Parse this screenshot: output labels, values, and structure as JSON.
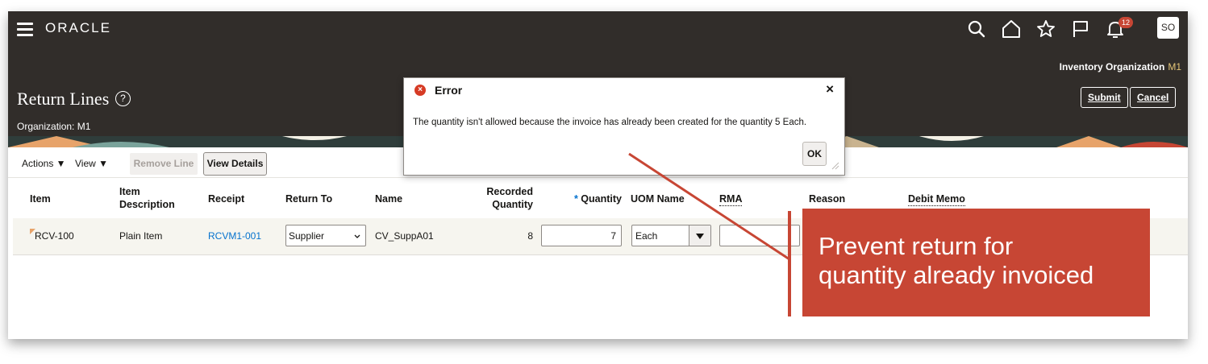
{
  "app": {
    "logo": "ORACLE",
    "notification_count": "12",
    "avatar_initials": "SO",
    "inventory_org_label": "Inventory Organization",
    "inventory_org_value": "M1"
  },
  "page": {
    "title": "Return Lines",
    "organization": "Organization: M1",
    "submit_label": "Submit",
    "cancel_label": "Cancel"
  },
  "toolbar": {
    "actions_label": "Actions ▼",
    "view_label": "View ▼",
    "remove_line_label": "Remove Line",
    "view_details_label": "View Details"
  },
  "table": {
    "columns": {
      "item": "Item",
      "item_description_1": "Item",
      "item_description_2": "Description",
      "receipt": "Receipt",
      "return_to": "Return To",
      "name": "Name",
      "recorded_qty_1": "Recorded",
      "recorded_qty_2": "Quantity",
      "quantity_required": "*",
      "quantity": "Quantity",
      "uom_name": "UOM Name",
      "rma": "RMA",
      "reason": "Reason",
      "debit_memo": "Debit Memo"
    },
    "row": {
      "item": "RCV-100",
      "description": "Plain Item",
      "receipt": "RCVM1-001",
      "return_to": "Supplier",
      "name": "CV_SuppA01",
      "recorded_quantity": "8",
      "quantity": "7",
      "uom": "Each",
      "rma": ""
    }
  },
  "dialog": {
    "title": "Error",
    "message": "The quantity isn't allowed because the invoice has already been created for the quantity 5 Each.",
    "ok_label": "OK",
    "close_glyph": "×"
  },
  "callout": {
    "line1": "Prevent return for",
    "line2": "quantity already invoiced"
  },
  "colors": {
    "header_bg": "#312d2a",
    "callout": "#c74634",
    "link": "#0572ce",
    "error_icon": "#d63b25"
  }
}
